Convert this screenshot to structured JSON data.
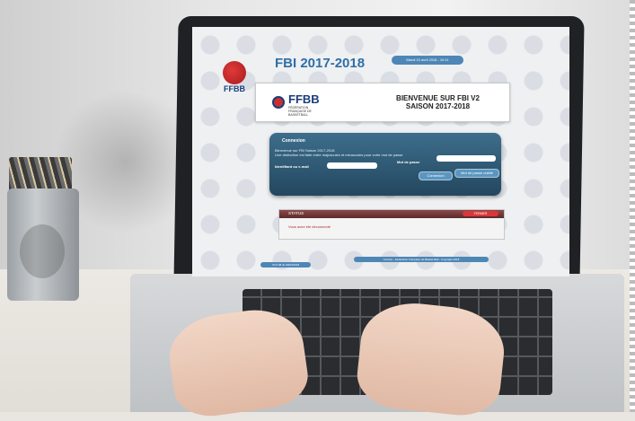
{
  "app": {
    "title": "FBI 2017-2018",
    "logo_text": "FFBB",
    "date_pill": "Mardi 10 avril 2018 - 10:11"
  },
  "welcome": {
    "brand": "FFBB",
    "federation": "FÉDÉRATION FRANÇAISE DE BASKETBALL",
    "heading_line1": "BIENVENUE SUR FBI V2",
    "heading_line2": "SAISON 2017-2018"
  },
  "login": {
    "title": "Connexion",
    "info_line1": "Bienvenue sur FBI Saison 2017-2018",
    "info_line2": "Une distinction est faite entre majuscules et minuscules pour votre mot de passe",
    "id_label": "Identifiant ou e-mail",
    "password_label": "Mot de passe",
    "id_value": "",
    "password_value": "",
    "connect_button": "Connexion",
    "forgot_button": "Mot de passe oublié"
  },
  "status": {
    "title": "STATUS",
    "badge": "FERMER",
    "message": "Vous avez été déconnecté"
  },
  "footer": {
    "version": "V2.5.38 du 09/04/2018",
    "copyright": "Contact - Fédération Française de Basket-Ball - Copyright 2018"
  },
  "colors": {
    "brand_blue": "#2f6fa5",
    "panel_dark": "#24475f",
    "status_red": "#d9373a"
  }
}
